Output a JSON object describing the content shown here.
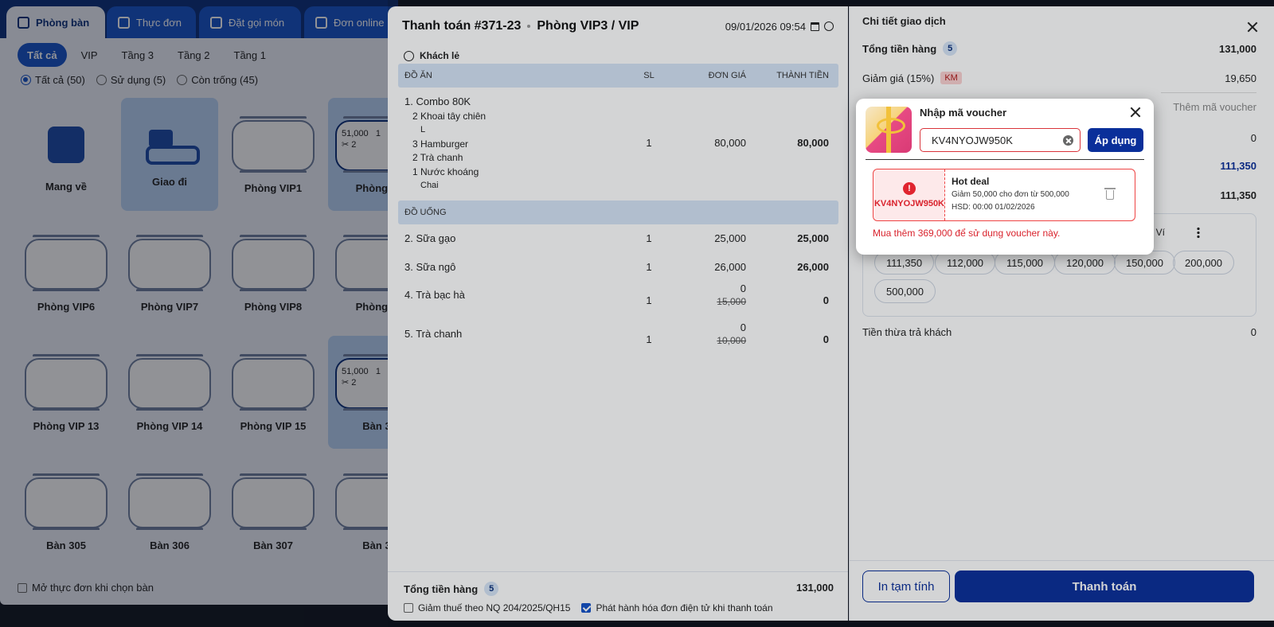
{
  "bg": {
    "tabs": [
      "Phòng bàn",
      "Thực đơn",
      "Đặt gọi món",
      "Đơn online"
    ],
    "filters": [
      "Tất cả",
      "VIP",
      "Tầng 3",
      "Tầng 2",
      "Tầng 1"
    ],
    "radios": [
      "Tất cả (50)",
      "Sử dụng (5)",
      "Còn trống (45)"
    ],
    "cards": [
      {
        "label": "Mang về"
      },
      {
        "label": "Giao đi"
      },
      {
        "label": "Phòng VIP1"
      },
      {
        "label": "Phòng V"
      },
      {
        "label": "Phòng VIP6"
      },
      {
        "label": "Phòng VIP7"
      },
      {
        "label": "Phòng VIP8"
      },
      {
        "label": "Phòng V"
      },
      {
        "label": "Phòng VIP 13"
      },
      {
        "label": "Phòng VIP 14"
      },
      {
        "label": "Phòng VIP 15"
      },
      {
        "label": "Bàn 3"
      },
      {
        "label": "Bàn 305"
      },
      {
        "label": "Bàn 306"
      },
      {
        "label": "Bàn 307"
      },
      {
        "label": "Bàn 3"
      }
    ],
    "busy_info": {
      "amount": "51,000",
      "guests": "2",
      "partial": "1"
    },
    "bottom_check": "Mở thực đơn khi chọn bàn"
  },
  "order": {
    "title": "Thanh toán #371-23",
    "room": "Phòng VIP3 / VIP",
    "datetime": "09/01/2026 09:54",
    "customer": "Khách lẻ",
    "columns": {
      "name": "ĐỒ ĂN",
      "qty": "SL",
      "price": "ĐƠN GIÁ",
      "total": "THÀNH TIỀN"
    },
    "section2": "ĐỒ UỐNG",
    "combo": {
      "name": "1. Combo 80K",
      "qty": "1",
      "price": "80,000",
      "total": "80,000",
      "subs": [
        "2 Khoai tây chiên",
        "L",
        "3 Hamburger",
        "2 Trà chanh",
        "1 Nước khoáng",
        "Chai"
      ]
    },
    "items": [
      {
        "name": "2. Sữa gạo",
        "qty": "1",
        "price": "25,000",
        "old": "",
        "total": "25,000"
      },
      {
        "name": "3. Sữa ngô",
        "qty": "1",
        "price": "26,000",
        "old": "",
        "total": "26,000"
      },
      {
        "name": "4. Trà bạc hà",
        "qty": "1",
        "price": "0",
        "old": "15,000",
        "total": "0"
      },
      {
        "name": "5. Trà chanh",
        "qty": "1",
        "price": "0",
        "old": "10,000",
        "total": "0"
      }
    ],
    "footer": {
      "total_label": "Tổng tiền hàng",
      "count": "5",
      "total": "131,000",
      "tax_check": "Giảm thuế theo NQ 204/2025/QH15",
      "einvoice_check": "Phát hành hóa đơn điện tử khi thanh toán"
    }
  },
  "detail": {
    "title": "Chi tiết giao dịch",
    "total_label": "Tổng tiền hàng",
    "count": "5",
    "total": "131,000",
    "discount_label": "Giảm giá (15%)",
    "km": "KM",
    "discount": "19,650",
    "voucher_add": "Thêm mã voucher",
    "row_zero": "0",
    "need_pay": "111,350",
    "paid": "111,350",
    "wallet_label": "Ví",
    "amounts": [
      "111,350",
      "112,000",
      "115,000",
      "120,000",
      "150,000",
      "200,000",
      "500,000"
    ],
    "change_label": "Tiền thừa trả khách",
    "change": "0",
    "btn_print": "In tạm tính",
    "btn_pay": "Thanh toán"
  },
  "voucher": {
    "title": "Nhập mã voucher",
    "code": "KV4NYOJW950K",
    "apply": "Áp dụng",
    "ticket_code": "KV4NYOJW950K",
    "ticket_name": "Hot deal",
    "ticket_desc": "Giảm 50,000 cho đơn từ 500,000",
    "ticket_exp": "HSD: 00:00 01/02/2026",
    "message": "Mua thêm 369,000 để sử dụng voucher này."
  },
  "colors": {
    "primary": "#0a2f9a",
    "danger": "#d9232d",
    "accent": "#1452c9"
  }
}
